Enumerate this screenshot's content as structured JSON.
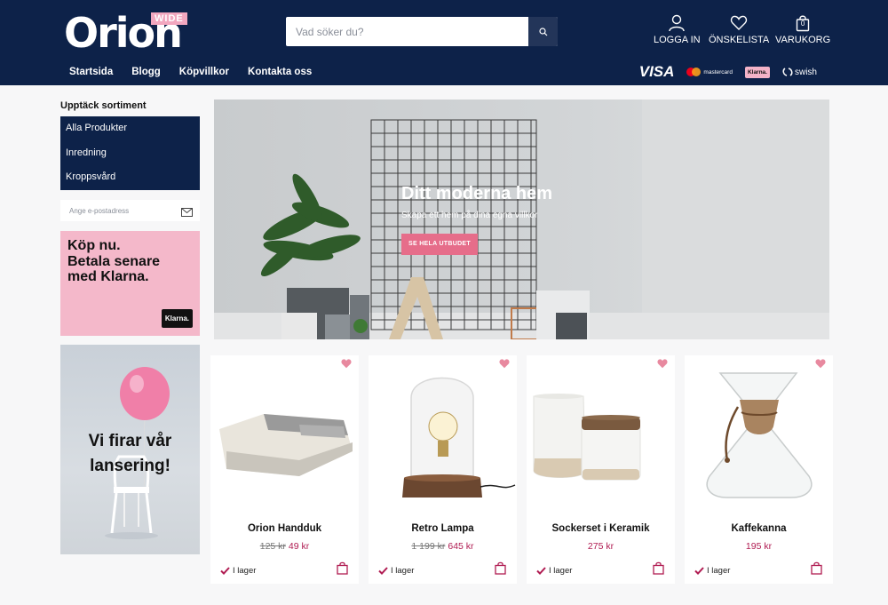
{
  "header": {
    "logo_text": "Orion",
    "logo_badge": "WIDE",
    "search_placeholder": "Vad söker du?",
    "actions": [
      {
        "label": "LOGGA IN",
        "icon": "user-icon"
      },
      {
        "label": "ÖNSKELISTA",
        "icon": "heart-icon"
      },
      {
        "label": "VARUKORG",
        "icon": "cart-bag-icon",
        "count": "0"
      }
    ],
    "nav": [
      "Startsida",
      "Blogg",
      "Köpvillkor",
      "Kontakta oss"
    ],
    "payments": {
      "visa": "VISA",
      "mastercard": "mastercard",
      "klarna": "Klarna.",
      "swish": "swish"
    }
  },
  "sidebar": {
    "title": "Upptäck sortiment",
    "menu": [
      "Alla Produkter",
      "Inredning",
      "Kroppsvård"
    ],
    "newsletter_placeholder": "Ange e-postadress",
    "klarna_ad": {
      "text": "Köp nu.\nBetala senare\nmed Klarna.",
      "badge": "Klarna."
    },
    "launch_ad": {
      "text": "Vi firar vår\nlansering!"
    }
  },
  "hero": {
    "title": "Ditt moderna hem",
    "subtitle": "Skapa ett hem på dina egna villkor",
    "button": "SE HELA UTBUDET"
  },
  "products": [
    {
      "name": "Orion Handduk",
      "old_price": "125 kr",
      "price": "49 kr",
      "stock": "I lager"
    },
    {
      "name": "Retro Lampa",
      "old_price": "1 199 kr",
      "price": "645 kr",
      "stock": "I lager"
    },
    {
      "name": "Sockerset i Keramik",
      "old_price": "",
      "price": "275 kr",
      "stock": "I lager"
    },
    {
      "name": "Kaffekanna",
      "old_price": "",
      "price": "195 kr",
      "stock": "I lager"
    }
  ],
  "colors": {
    "navy": "#0d2249",
    "pink": "#f4b8ca",
    "accent": "#e66d8a",
    "price": "#b01c52"
  }
}
